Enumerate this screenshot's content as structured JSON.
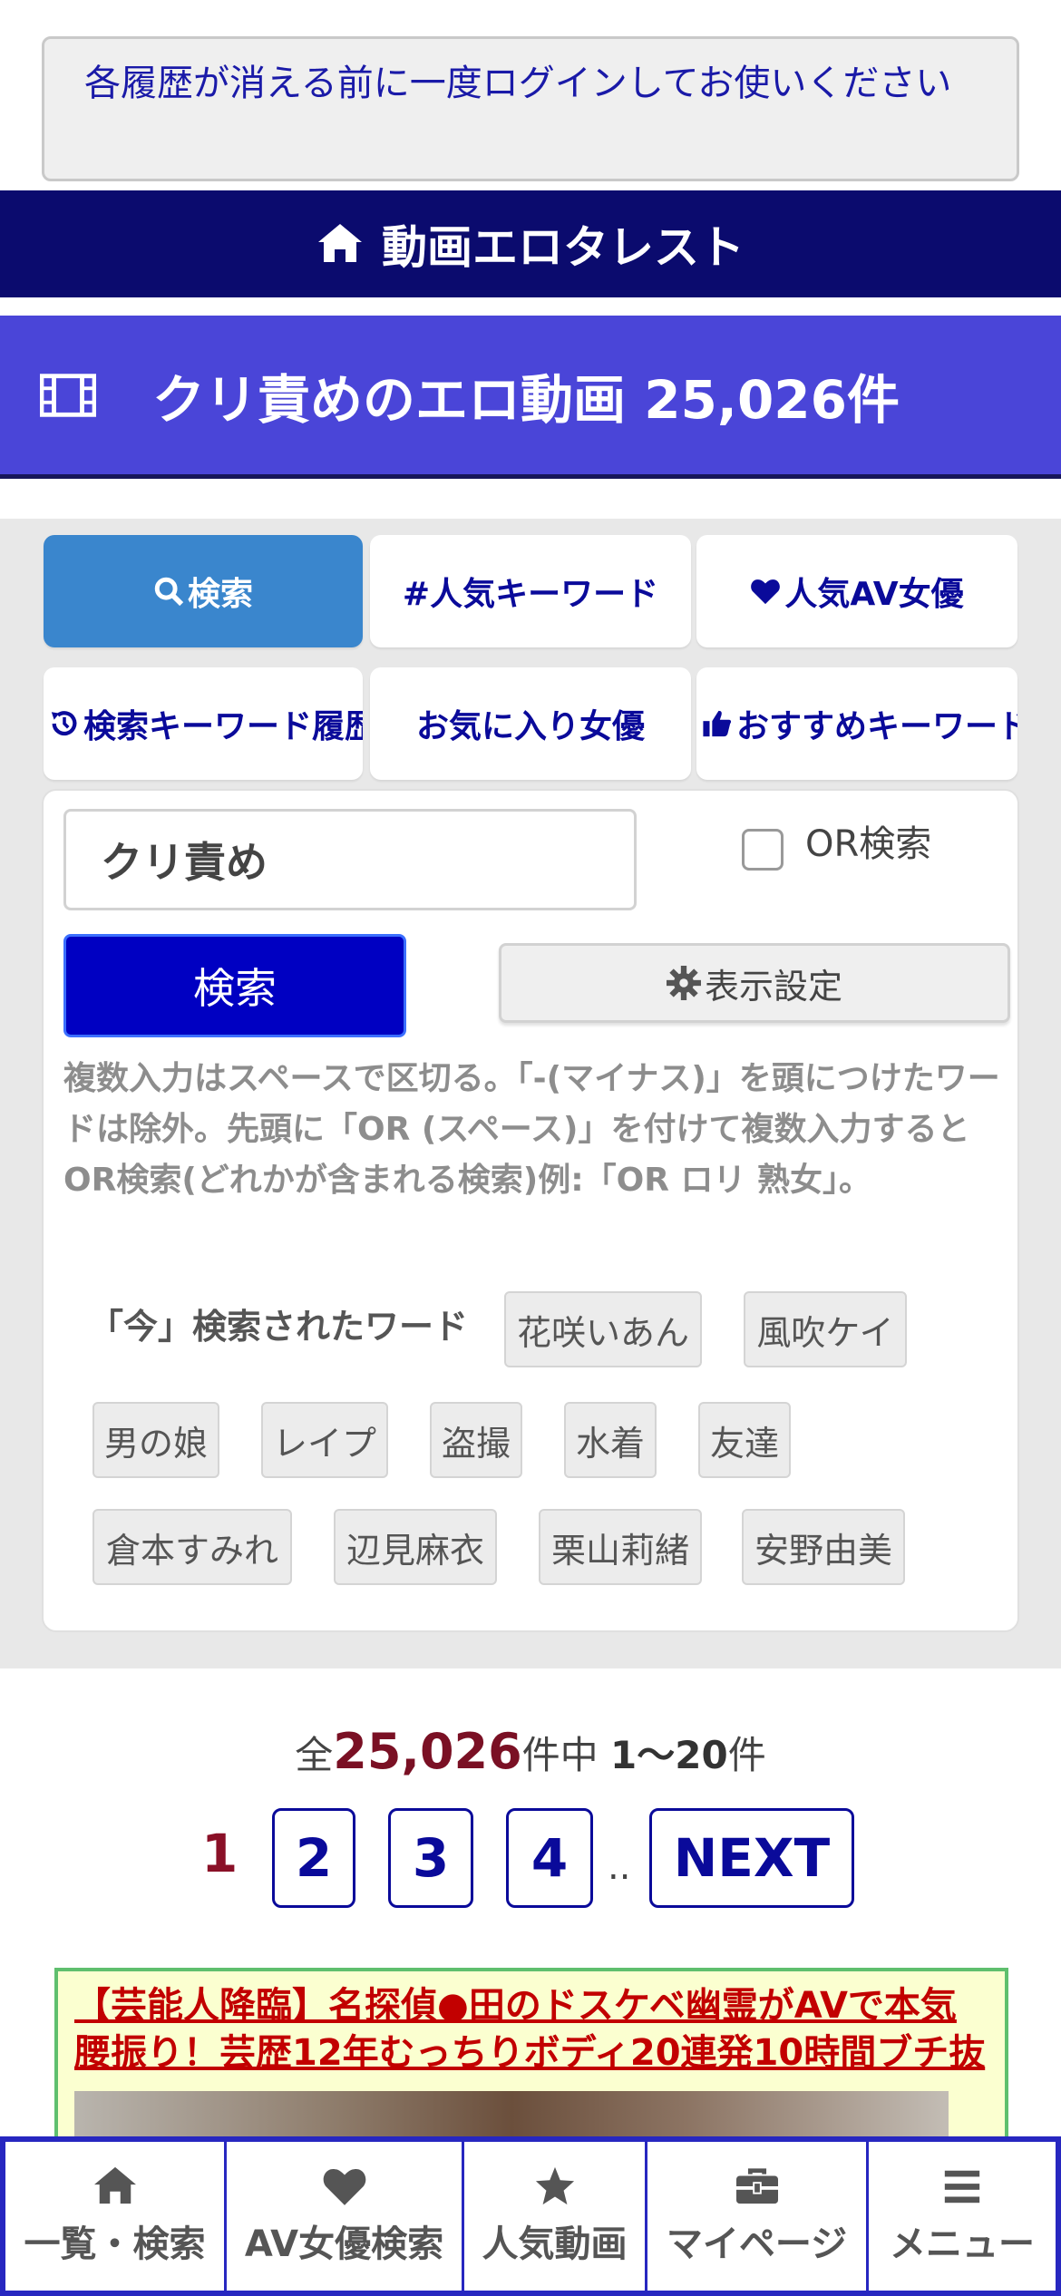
{
  "notice": {
    "text": "各履歴が消える前に一度ログインしてお使いください"
  },
  "site": {
    "title": "動画エロタレスト",
    "icon": "home-icon"
  },
  "page_header": {
    "title": "クリ責めのエロ動画 25,026件",
    "icon": "film-icon"
  },
  "tabs": [
    {
      "label": "検索",
      "icon": "search-icon",
      "active": true
    },
    {
      "label": "#人気キーワード",
      "icon": ""
    },
    {
      "label": "人気AV女優",
      "icon": "heart-icon"
    },
    {
      "label": "検索キーワード履歴",
      "icon": "history-icon"
    },
    {
      "label": "お気に入り女優",
      "icon": ""
    },
    {
      "label": "おすすめキーワード",
      "icon": "thumbs-up-icon"
    }
  ],
  "search": {
    "value": "クリ責め",
    "or_label": "OR検索",
    "button_label": "検索",
    "settings_label": "表示設定",
    "help": "複数入力はスペースで区切る。「-(マイナス)」を頭につけたワードは除外。先頭に「OR (スペース)」を付けて複数入力するとOR検索(どれかが含まれる検索)例:「OR ロリ 熟女」。"
  },
  "trending": {
    "label": "「今」検索されたワード",
    "words": [
      "花咲いあん",
      "風吹ケイ",
      "男の娘",
      "レイプ",
      "盗撮",
      "水着",
      "友達",
      "倉本すみれ",
      "辺見麻衣",
      "栗山莉緒",
      "安野由美"
    ]
  },
  "results": {
    "prefix": "全",
    "total": "25,026",
    "middle": "件中 ",
    "range": "1～20",
    "suffix": "件"
  },
  "pagination": {
    "current": "1",
    "pages": [
      "2",
      "3",
      "4"
    ],
    "ellipsis": "..",
    "next": "NEXT"
  },
  "ad": {
    "text": "【芸能人降臨】名探偵●田のドスケベ幽霊がAVで本気腰振り！芸歴12年むっちりボディ20連発10時間ブチ抜"
  },
  "bottom_nav": [
    {
      "label": "一覧・検索",
      "icon": "home-icon"
    },
    {
      "label": "AV女優検索",
      "icon": "heart-icon"
    },
    {
      "label": "人気動画",
      "icon": "star-icon"
    },
    {
      "label": "マイページ",
      "icon": "briefcase-icon"
    },
    {
      "label": "メニュー",
      "icon": "menu-icon"
    }
  ],
  "colors": {
    "site_bar": "#0b0b6e",
    "title_bar": "#4a45d8",
    "active_tab": "#3a86cd",
    "search_button": "#0000c2",
    "accent_red": "#7a1024",
    "nav_border": "#2727c0"
  }
}
